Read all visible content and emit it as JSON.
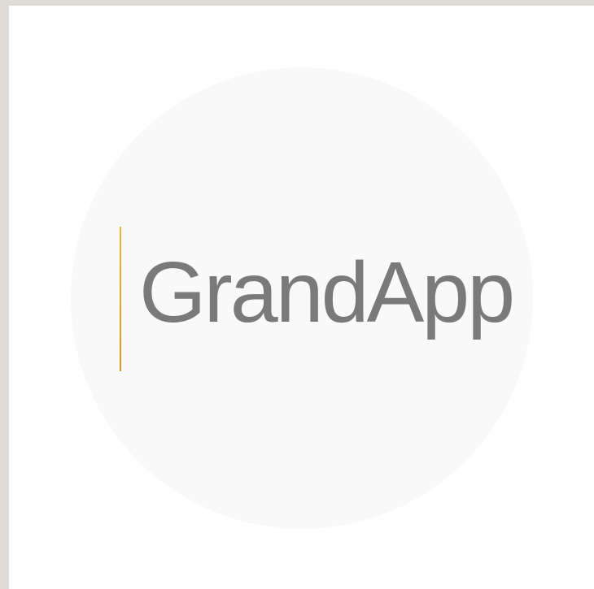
{
  "app": {
    "name": "GrandApp"
  },
  "colors": {
    "page_background": "#dedbd4",
    "frame_background": "#ffffff",
    "circle_background": "#f9f9f9",
    "accent": "#e8a22a",
    "wordmark_text": "#7a7a7a"
  }
}
